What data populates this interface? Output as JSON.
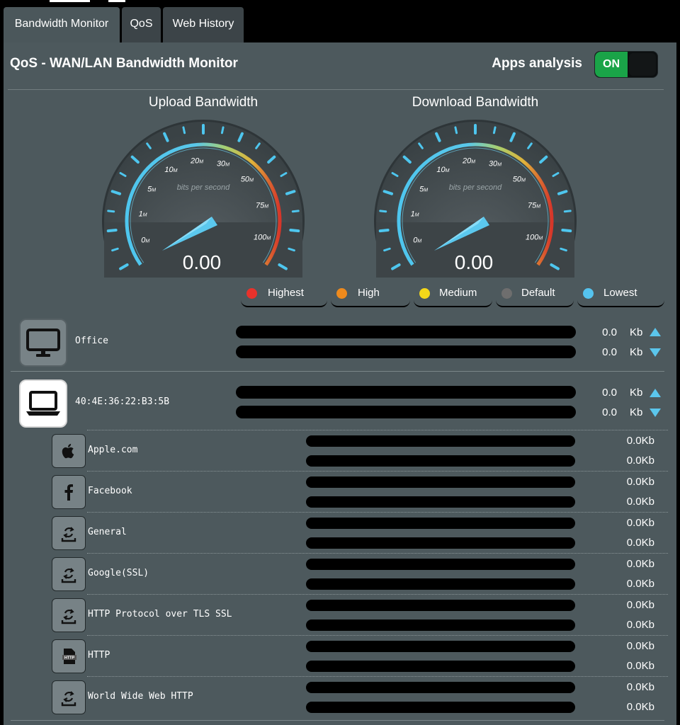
{
  "tabs": [
    {
      "label": "Bandwidth Monitor",
      "active": true
    },
    {
      "label": "QoS",
      "active": false
    },
    {
      "label": "Web History",
      "active": false
    }
  ],
  "header": {
    "title": "QoS - WAN/LAN Bandwidth Monitor",
    "apps_analysis_label": "Apps analysis",
    "apps_analysis_state": "ON"
  },
  "gauges": {
    "upload": {
      "title": "Upload Bandwidth",
      "value": "0.00"
    },
    "download": {
      "title": "Download Bandwidth",
      "value": "0.00"
    },
    "unit_caption": "bits per second",
    "scale": [
      "0",
      "1",
      "5",
      "10",
      "20",
      "30",
      "50",
      "75",
      "100"
    ],
    "scale_suffix": "M"
  },
  "legend": [
    {
      "label": "Highest",
      "color": "#e8322b"
    },
    {
      "label": "High",
      "color": "#ee8a1d"
    },
    {
      "label": "Medium",
      "color": "#f4d719"
    },
    {
      "label": "Default",
      "color": "#6e6e6e"
    },
    {
      "label": "Lowest",
      "color": "#55c3ee"
    }
  ],
  "devices": [
    {
      "name": "Office",
      "icon": "desktop-computer-icon",
      "up_value": "0.0",
      "down_value": "0.0",
      "unit": "Kb"
    },
    {
      "name": "40:4E:36:22:B3:5B",
      "icon": "laptop-icon",
      "up_value": "0.0",
      "down_value": "0.0",
      "unit": "Kb"
    }
  ],
  "apps": [
    {
      "name": "Apple.com",
      "icon": "apple-icon",
      "up": "0.0Kb",
      "down": "0.0Kb"
    },
    {
      "name": "Facebook",
      "icon": "facebook-icon",
      "up": "0.0Kb",
      "down": "0.0Kb"
    },
    {
      "name": "General",
      "icon": "general-app-icon",
      "up": "0.0Kb",
      "down": "0.0Kb"
    },
    {
      "name": "Google(SSL)",
      "icon": "general-app-icon",
      "up": "0.0Kb",
      "down": "0.0Kb"
    },
    {
      "name": "HTTP Protocol over TLS SSL",
      "icon": "general-app-icon",
      "up": "0.0Kb",
      "down": "0.0Kb"
    },
    {
      "name": "HTTP",
      "icon": "http-file-icon",
      "up": "0.0Kb",
      "down": "0.0Kb"
    },
    {
      "name": "World Wide Web HTTP",
      "icon": "general-app-icon",
      "up": "0.0Kb",
      "down": "0.0Kb"
    }
  ]
}
